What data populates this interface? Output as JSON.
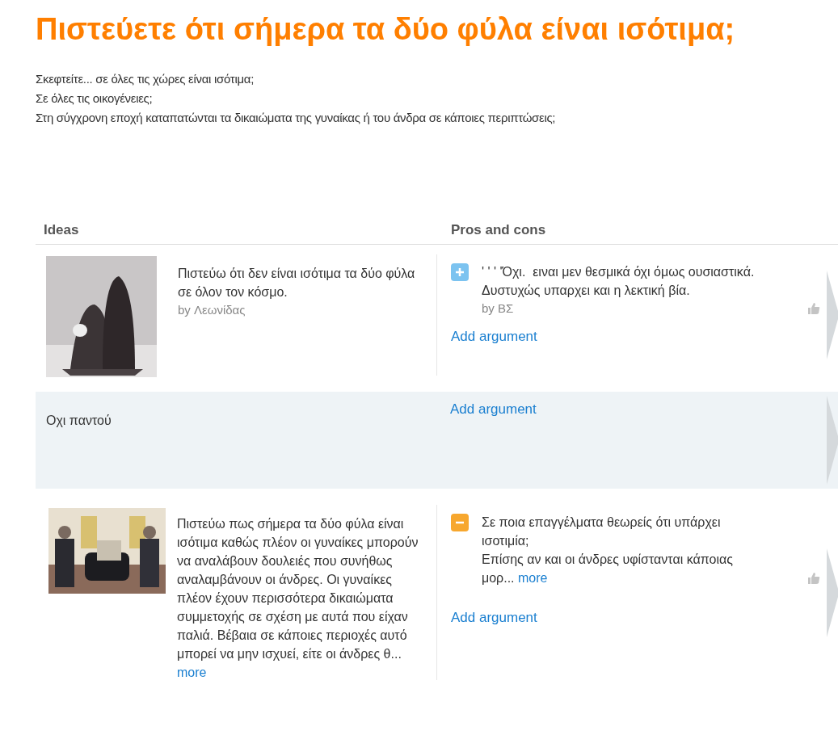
{
  "title": "Πιστεύετε ότι σήμερα τα δύο φύλα είναι ισότιμα;",
  "intro": [
    "Σκεφτείτε... σε όλες τις χώρες είναι ισότιμα;",
    "Σε όλες τις οικογένειες;",
    "Στη σύγχρονη εποχή καταπατώνται τα δικαιώματα της γυναίκας ή του άνδρα σε κάποιες περιπτώσεις;"
  ],
  "table": {
    "columns": [
      "Ideas",
      "Pros and cons"
    ],
    "rows": [
      {
        "idea": {
          "kind": "picture",
          "text": "Πιστεύω ότι δεν είναι ισότιμα τα δύο φύλα σε όλον τον κόσμο.",
          "author": "by Λεωνίδας"
        },
        "arguments": [
          {
            "kind": "pro",
            "text": "' ' ' 'Όχι.  ειναι μεν θεσμικά όχι όμως ουσιαστικά. Δυστυχώς υπαρχει και η λεκτική βία.",
            "author": "by ΒΣ"
          }
        ],
        "add": "Add argument"
      },
      {
        "idea": {
          "kind": "text",
          "text": "Οχι παντού"
        },
        "arguments": [],
        "add": "Add argument"
      },
      {
        "idea": {
          "kind": "picture",
          "text": "Πιστεύω πως σήμερα τα δύο φύλα είναι ισότιμα καθώς πλέον οι γυναίκες μπορούν να αναλάβουν δουλειές που συνήθως αναλαμβάνουν οι άνδρες. Οι γυναίκες πλέον έχουν περισσότερα δικαιώματα συμμετοχής σε σχέση με αυτά που είχαν παλιά. Βέβαια σε κάποιες περιοχές αυτό μπορεί να μην ισχυεί, είτε οι άνδρες θ...",
          "more": "more"
        },
        "arguments": [
          {
            "kind": "con",
            "text": "Σε ποια επαγγέλματα θεωρείς ότι υπάρχει ισοτιμία;\nΕπίσης αν και οι άνδρες υφίστανται κάποιας μορ...",
            "more": "more"
          }
        ],
        "add": "Add argument"
      }
    ]
  }
}
